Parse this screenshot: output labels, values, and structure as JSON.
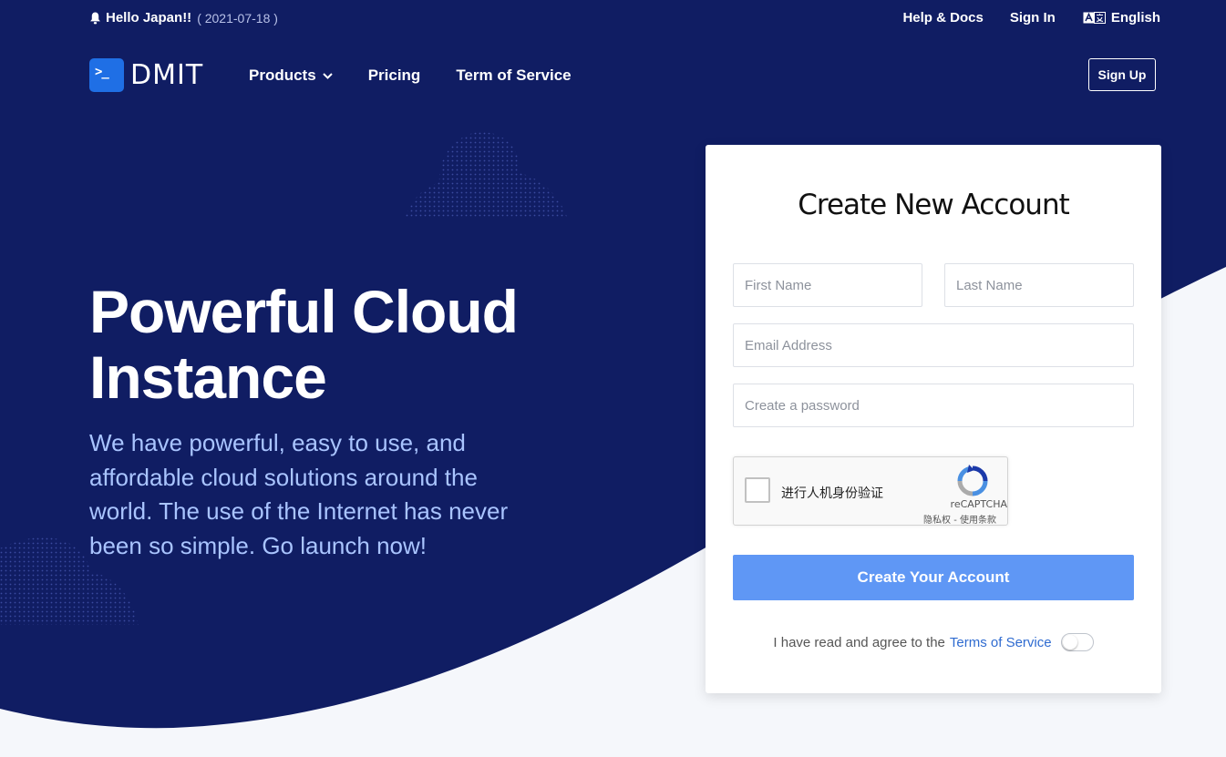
{
  "announcement": {
    "text": "Hello Japan!!",
    "date": "( 2021-07-18 )",
    "icon": "bell-icon"
  },
  "top_links": {
    "help": "Help & Docs",
    "signin": "Sign In",
    "language": "English",
    "language_icon": "translate-icon"
  },
  "brand": {
    "name": "DMIT",
    "logo_glyph": ">_",
    "logo_color": "#1f6fe5"
  },
  "nav": {
    "products": "Products",
    "pricing": "Pricing",
    "tos": "Term of Service",
    "signup": "Sign Up"
  },
  "hero": {
    "title_line1": "Powerful Cloud",
    "title_line2": "Instance",
    "subtitle": "We have powerful, easy to use, and affordable cloud solutions around the world. The use of the Internet has never been so simple. Go launch now!"
  },
  "form": {
    "title": "Create New Account",
    "first_name_placeholder": "First Name",
    "last_name_placeholder": "Last Name",
    "email_placeholder": "Email Address",
    "password_placeholder": "Create a password",
    "captcha": {
      "label": "进行人机身份验证",
      "brand": "reCAPTCHA",
      "privacy": "隐私权",
      "separator": " - ",
      "terms": "使用条款"
    },
    "submit": "Create Your Account",
    "agree_text": "I have read and agree to the",
    "agree_link": "Terms of Service",
    "agree_toggle_on": false
  },
  "colors": {
    "hero_bg": "#101d63",
    "accent": "#5f97f5",
    "link": "#2f6bd0",
    "subtitle": "#a9c4ff"
  }
}
